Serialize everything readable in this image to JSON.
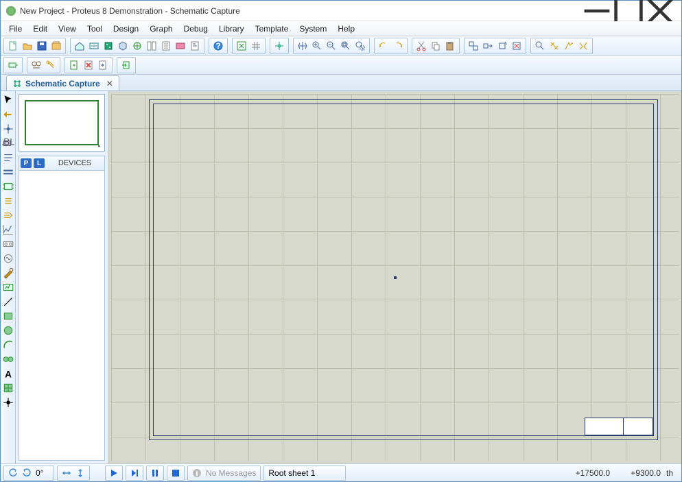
{
  "title": "New Project - Proteus 8 Demonstration - Schematic Capture",
  "menu": [
    "File",
    "Edit",
    "View",
    "Tool",
    "Design",
    "Graph",
    "Debug",
    "Library",
    "Template",
    "System",
    "Help"
  ],
  "tab": {
    "label": "Schematic Capture"
  },
  "devices": {
    "label": "DEVICES",
    "p_btn": "P",
    "l_btn": "L"
  },
  "status": {
    "angle": "0°",
    "no_messages": "No Messages",
    "sheet": "Root sheet 1",
    "x": "+17500.0",
    "y": "+9300.0",
    "unit": "th"
  }
}
